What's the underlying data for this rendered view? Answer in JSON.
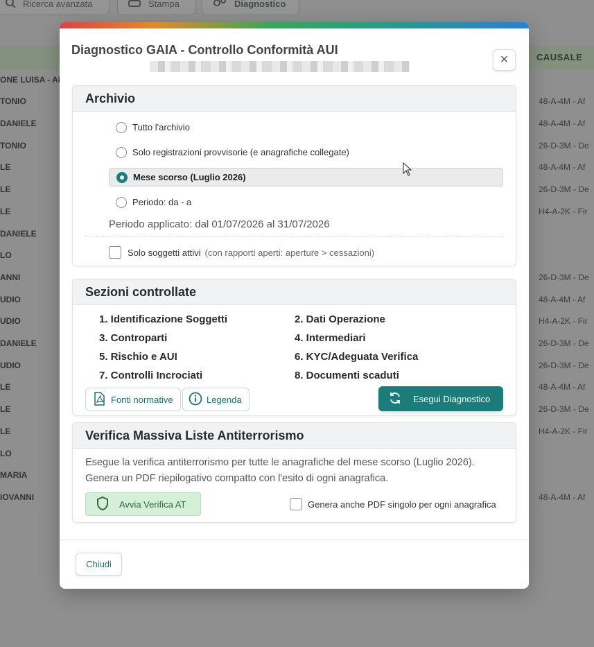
{
  "background": {
    "toolbar": {
      "advanced_search": "Ricerca avanzata",
      "print": "Stampa",
      "diagnostic": "Diagnostico"
    },
    "causale_header": "CAUSALE",
    "rows": [
      {
        "name": "ONE LUISA - AB",
        "causale": ""
      },
      {
        "name": "TONIO",
        "causale": "48-A-4M - Af"
      },
      {
        "name": "DANIELE",
        "causale": "48-A-4M - Af"
      },
      {
        "name": "TONIO",
        "causale": "26-D-3M - De"
      },
      {
        "name": "LE",
        "causale": "48-A-4M - Af"
      },
      {
        "name": "LE",
        "causale": "26-D-3M - De"
      },
      {
        "name": "LE",
        "causale": "H4-A-2K - Fir"
      },
      {
        "name": "DANIELE",
        "causale": ""
      },
      {
        "name": "LO",
        "causale": ""
      },
      {
        "name": "ANNI",
        "causale": "26-D-3M - De"
      },
      {
        "name": "UDIO",
        "causale": "48-A-4M - Af"
      },
      {
        "name": "UDIO",
        "causale": "H4-A-2K - Fir"
      },
      {
        "name": "DANIELE",
        "causale": "26-D-3M - De"
      },
      {
        "name": "UDIO",
        "causale": "26-D-3M - De"
      },
      {
        "name": "LE",
        "causale": "48-A-4M - Af"
      },
      {
        "name": "LE",
        "causale": "26-D-3M - De"
      },
      {
        "name": "LE",
        "causale": "H4-A-2K - Fir"
      },
      {
        "name": "LO",
        "causale": ""
      },
      {
        "name": "MARIA",
        "causale": ""
      },
      {
        "name": "IOVANNI",
        "causale": "48-A-4M - Af"
      }
    ]
  },
  "modal": {
    "title": "Diagnostico GAIA - Controllo Conformità AUI",
    "close_symbol": "×",
    "archivio": {
      "heading": "Archivio",
      "options": [
        {
          "label": "Tutto l'archivio",
          "selected": false
        },
        {
          "label": "Solo registrazioni provvisorie (e anagrafiche collegate)",
          "selected": false
        },
        {
          "label": "Mese scorso (Luglio 2026)",
          "selected": true
        },
        {
          "label": "Periodo: da - a",
          "selected": false
        }
      ],
      "periodo_applicato": "Periodo applicato: dal 01/07/2026 al 31/07/2026",
      "solo_attivi_label": "Solo soggetti attivi",
      "solo_attivi_hint": "(con rapporti aperti: aperture > cessazioni)",
      "solo_attivi_checked": false
    },
    "sezioni": {
      "heading": "Sezioni controllate",
      "items": [
        "1. Identificazione Soggetti",
        "2. Dati Operazione",
        "3. Controparti",
        "4. Intermediari",
        "5. Rischio e AUI",
        "6. KYC/Adeguata Verifica",
        "7. Controlli Incrociati",
        "8. Documenti scaduti"
      ],
      "fonti_label": "Fonti normative",
      "legenda_label": "Legenda",
      "esegui_label": "Esegui Diagnostico"
    },
    "verifica": {
      "heading": "Verifica Massiva Liste Antiterrorismo",
      "description": "Esegue la verifica antiterrorismo per tutte le anagrafiche del mese scorso (Luglio 2026). Genera un PDF riepilogativo compatto con l'esito di ogni anagrafica.",
      "avvia_label": "Avvia Verifica AT",
      "pdf_label": "Genera anche PDF singolo per ogni anagrafica",
      "pdf_checked": false
    },
    "chiudi_label": "Chiudi"
  },
  "colors": {
    "primary": "#1b7c7a",
    "green_button_bg": "#d5efd9",
    "overlay": "#8f8f8f"
  }
}
